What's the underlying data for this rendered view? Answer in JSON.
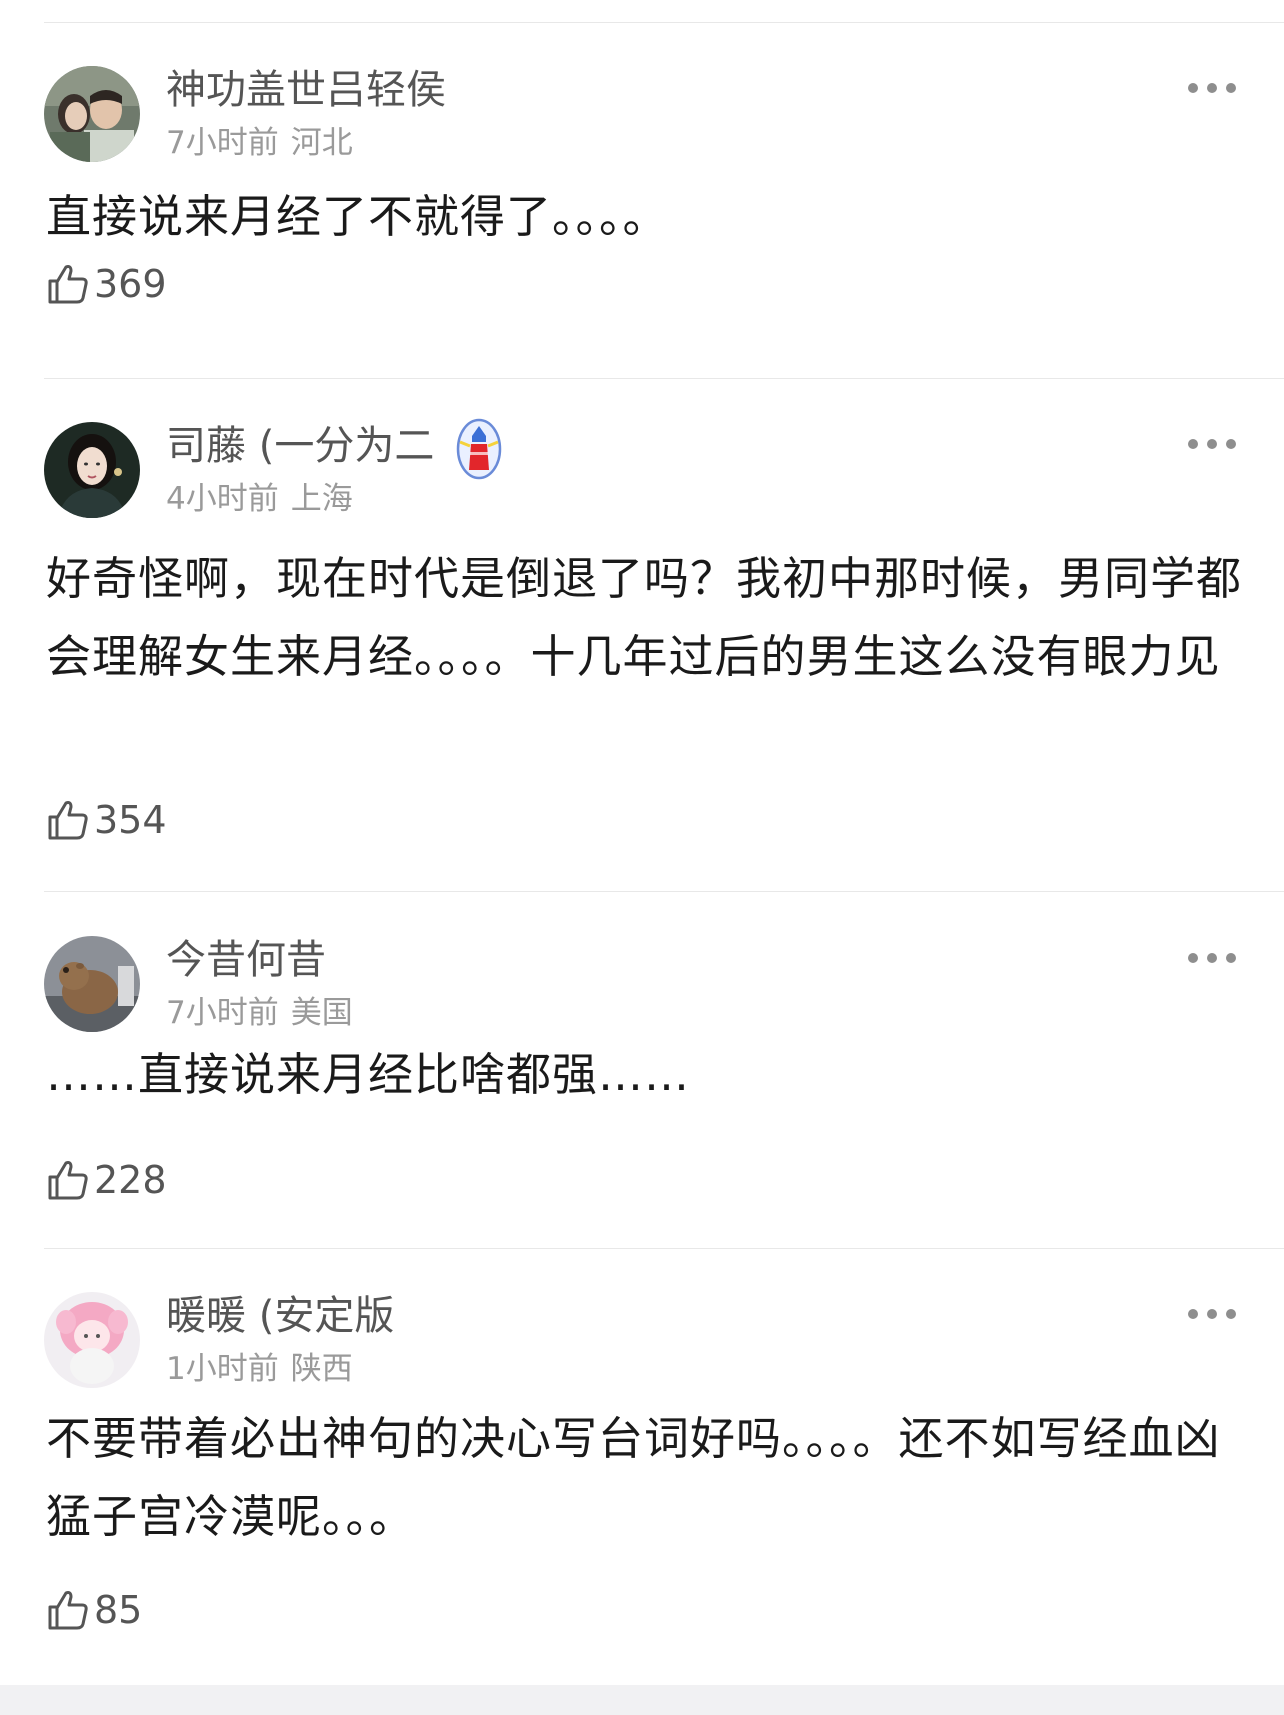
{
  "comments": [
    {
      "username": "神功盖世吕轻侯",
      "time": "7小时前",
      "location": "河北",
      "content": "直接说来月经了不就得了。。。。",
      "likes": "369",
      "avatar_icon": "avatar-photo-couple"
    },
    {
      "username": "司藤 (一分为二",
      "time": "4小时前",
      "location": "上海",
      "content": "好奇怪啊，现在时代是倒退了吗？我初中那时候，男同学都会理解女生来月经。。。。十几年过后的男生这么没有眼力见",
      "likes": "354",
      "avatar_icon": "avatar-photo-woman",
      "badge_icon": "lighthouse-badge-icon"
    },
    {
      "username": "今昔何昔",
      "time": "7小时前",
      "location": "美国",
      "content": "……直接说来月经比啥都强……",
      "likes": "228",
      "avatar_icon": "avatar-photo-capybara"
    },
    {
      "username": "暖暖 (安定版",
      "time": "1小时前",
      "location": "陕西",
      "content": "不要带着必出神句的决心写台词好吗。。。。还不如写经血凶猛子宫冷漠呢。。。",
      "likes": "85",
      "avatar_icon": "avatar-photo-pink-doll"
    }
  ],
  "colors": {
    "username": "#555555",
    "meta": "#9a9a9a",
    "content": "#1a1a1a",
    "divider": "#e8e8e8"
  }
}
